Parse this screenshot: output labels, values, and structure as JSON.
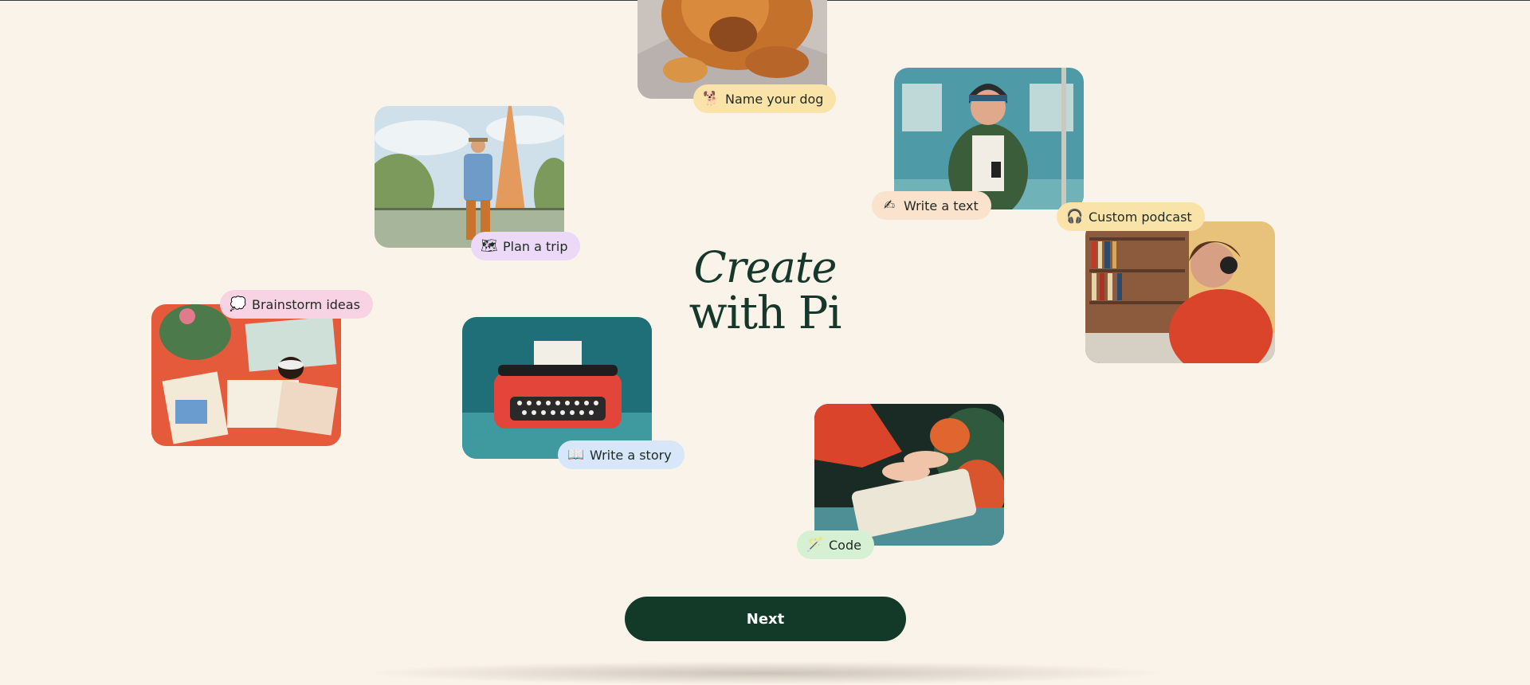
{
  "headline": {
    "line1": "Create",
    "line2": "with Pi"
  },
  "cards": {
    "dog": {
      "label": "Name your dog",
      "icon": "🐕"
    },
    "trip": {
      "label": "Plan a trip",
      "icon": "🗺"
    },
    "text": {
      "label": "Write a text",
      "icon": "✍"
    },
    "podcast": {
      "label": "Custom podcast",
      "icon": "🎧"
    },
    "brainstorm": {
      "label": "Brainstorm ideas",
      "icon": "💭"
    },
    "story": {
      "label": "Write a story",
      "icon": "📖"
    },
    "code": {
      "label": "Code",
      "icon": "🪄"
    }
  },
  "next_button": {
    "label": "Next"
  },
  "colors": {
    "background": "#faf3ea",
    "primary": "#133a28",
    "pill_yellow": "#f9e3a8",
    "pill_lavender": "#ebd9f7",
    "pill_peach": "#fbe2cc",
    "pill_pink": "#f7d3e3",
    "pill_blue": "#d7e6f9",
    "pill_green": "#d5f0d3"
  }
}
